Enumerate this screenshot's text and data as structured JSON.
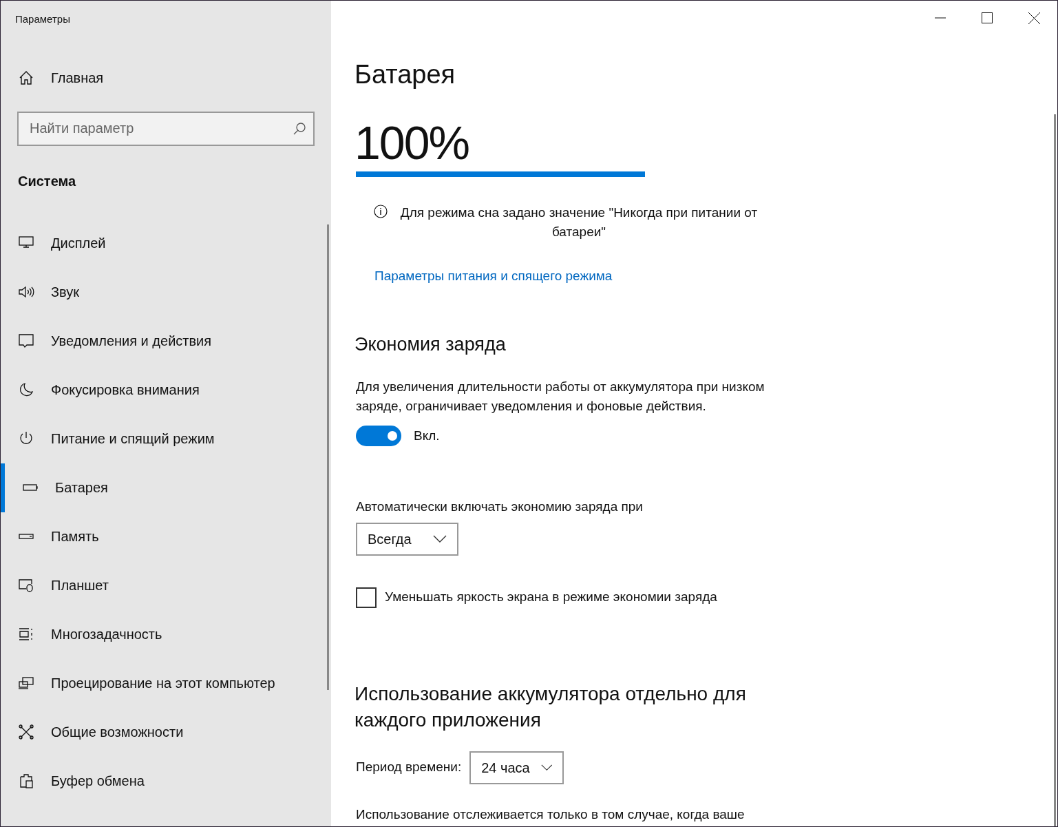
{
  "window": {
    "title": "Параметры"
  },
  "sidebar": {
    "home": "Главная",
    "search": {
      "placeholder": "Найти параметр"
    },
    "section": "Система",
    "items": [
      {
        "label": "Дисплей",
        "selected": false
      },
      {
        "label": "Звук",
        "selected": false
      },
      {
        "label": "Уведомления и действия",
        "selected": false
      },
      {
        "label": "Фокусировка внимания",
        "selected": false
      },
      {
        "label": "Питание и спящий режим",
        "selected": false
      },
      {
        "label": "Батарея",
        "selected": true
      },
      {
        "label": "Память",
        "selected": false
      },
      {
        "label": "Планшет",
        "selected": false
      },
      {
        "label": "Многозадачность",
        "selected": false
      },
      {
        "label": "Проецирование на этот компьютер",
        "selected": false
      },
      {
        "label": "Общие возможности",
        "selected": false
      },
      {
        "label": "Буфер обмена",
        "selected": false
      }
    ]
  },
  "main": {
    "title": "Батарея",
    "percent": "100%",
    "level": 1.0,
    "info": "Для режима сна задано значение \"Никогда при питании от батареи\"",
    "link": "Параметры питания и спящего режима",
    "saver": {
      "title": "Экономия заряда",
      "description": "Для увеличения длительности работы от аккумулятора при низком заряде, ограничивает уведомления и фоновые действия.",
      "toggle": {
        "on": true,
        "label": "Вкл."
      },
      "auto_label": "Автоматически включать экономию заряда при",
      "auto_value": "Всегда",
      "brightness": {
        "label": "Уменьшать яркость экрана в режиме экономии заряда",
        "checked": false
      }
    },
    "usage": {
      "title": "Использование аккумулятора отдельно для каждого приложения",
      "period_label": "Период времени:",
      "period_value": "24 часа",
      "note": "Использование отслеживается только в том случае, когда ваше"
    }
  }
}
